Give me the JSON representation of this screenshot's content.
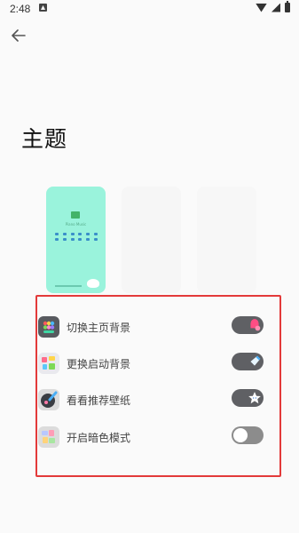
{
  "status_bar": {
    "time": "2:48"
  },
  "page": {
    "title": "主题"
  },
  "settings": {
    "items": [
      {
        "label": "切换主页背景"
      },
      {
        "label": "更换启动背景"
      },
      {
        "label": "看看推荐壁纸"
      },
      {
        "label": "开启暗色模式"
      }
    ]
  },
  "preview": {
    "app_caption": "Piano Music"
  },
  "colors": {
    "highlight_border": "#e33a3a",
    "toggle_track": "#5f6064",
    "preview_bg": "#9af3dc"
  }
}
